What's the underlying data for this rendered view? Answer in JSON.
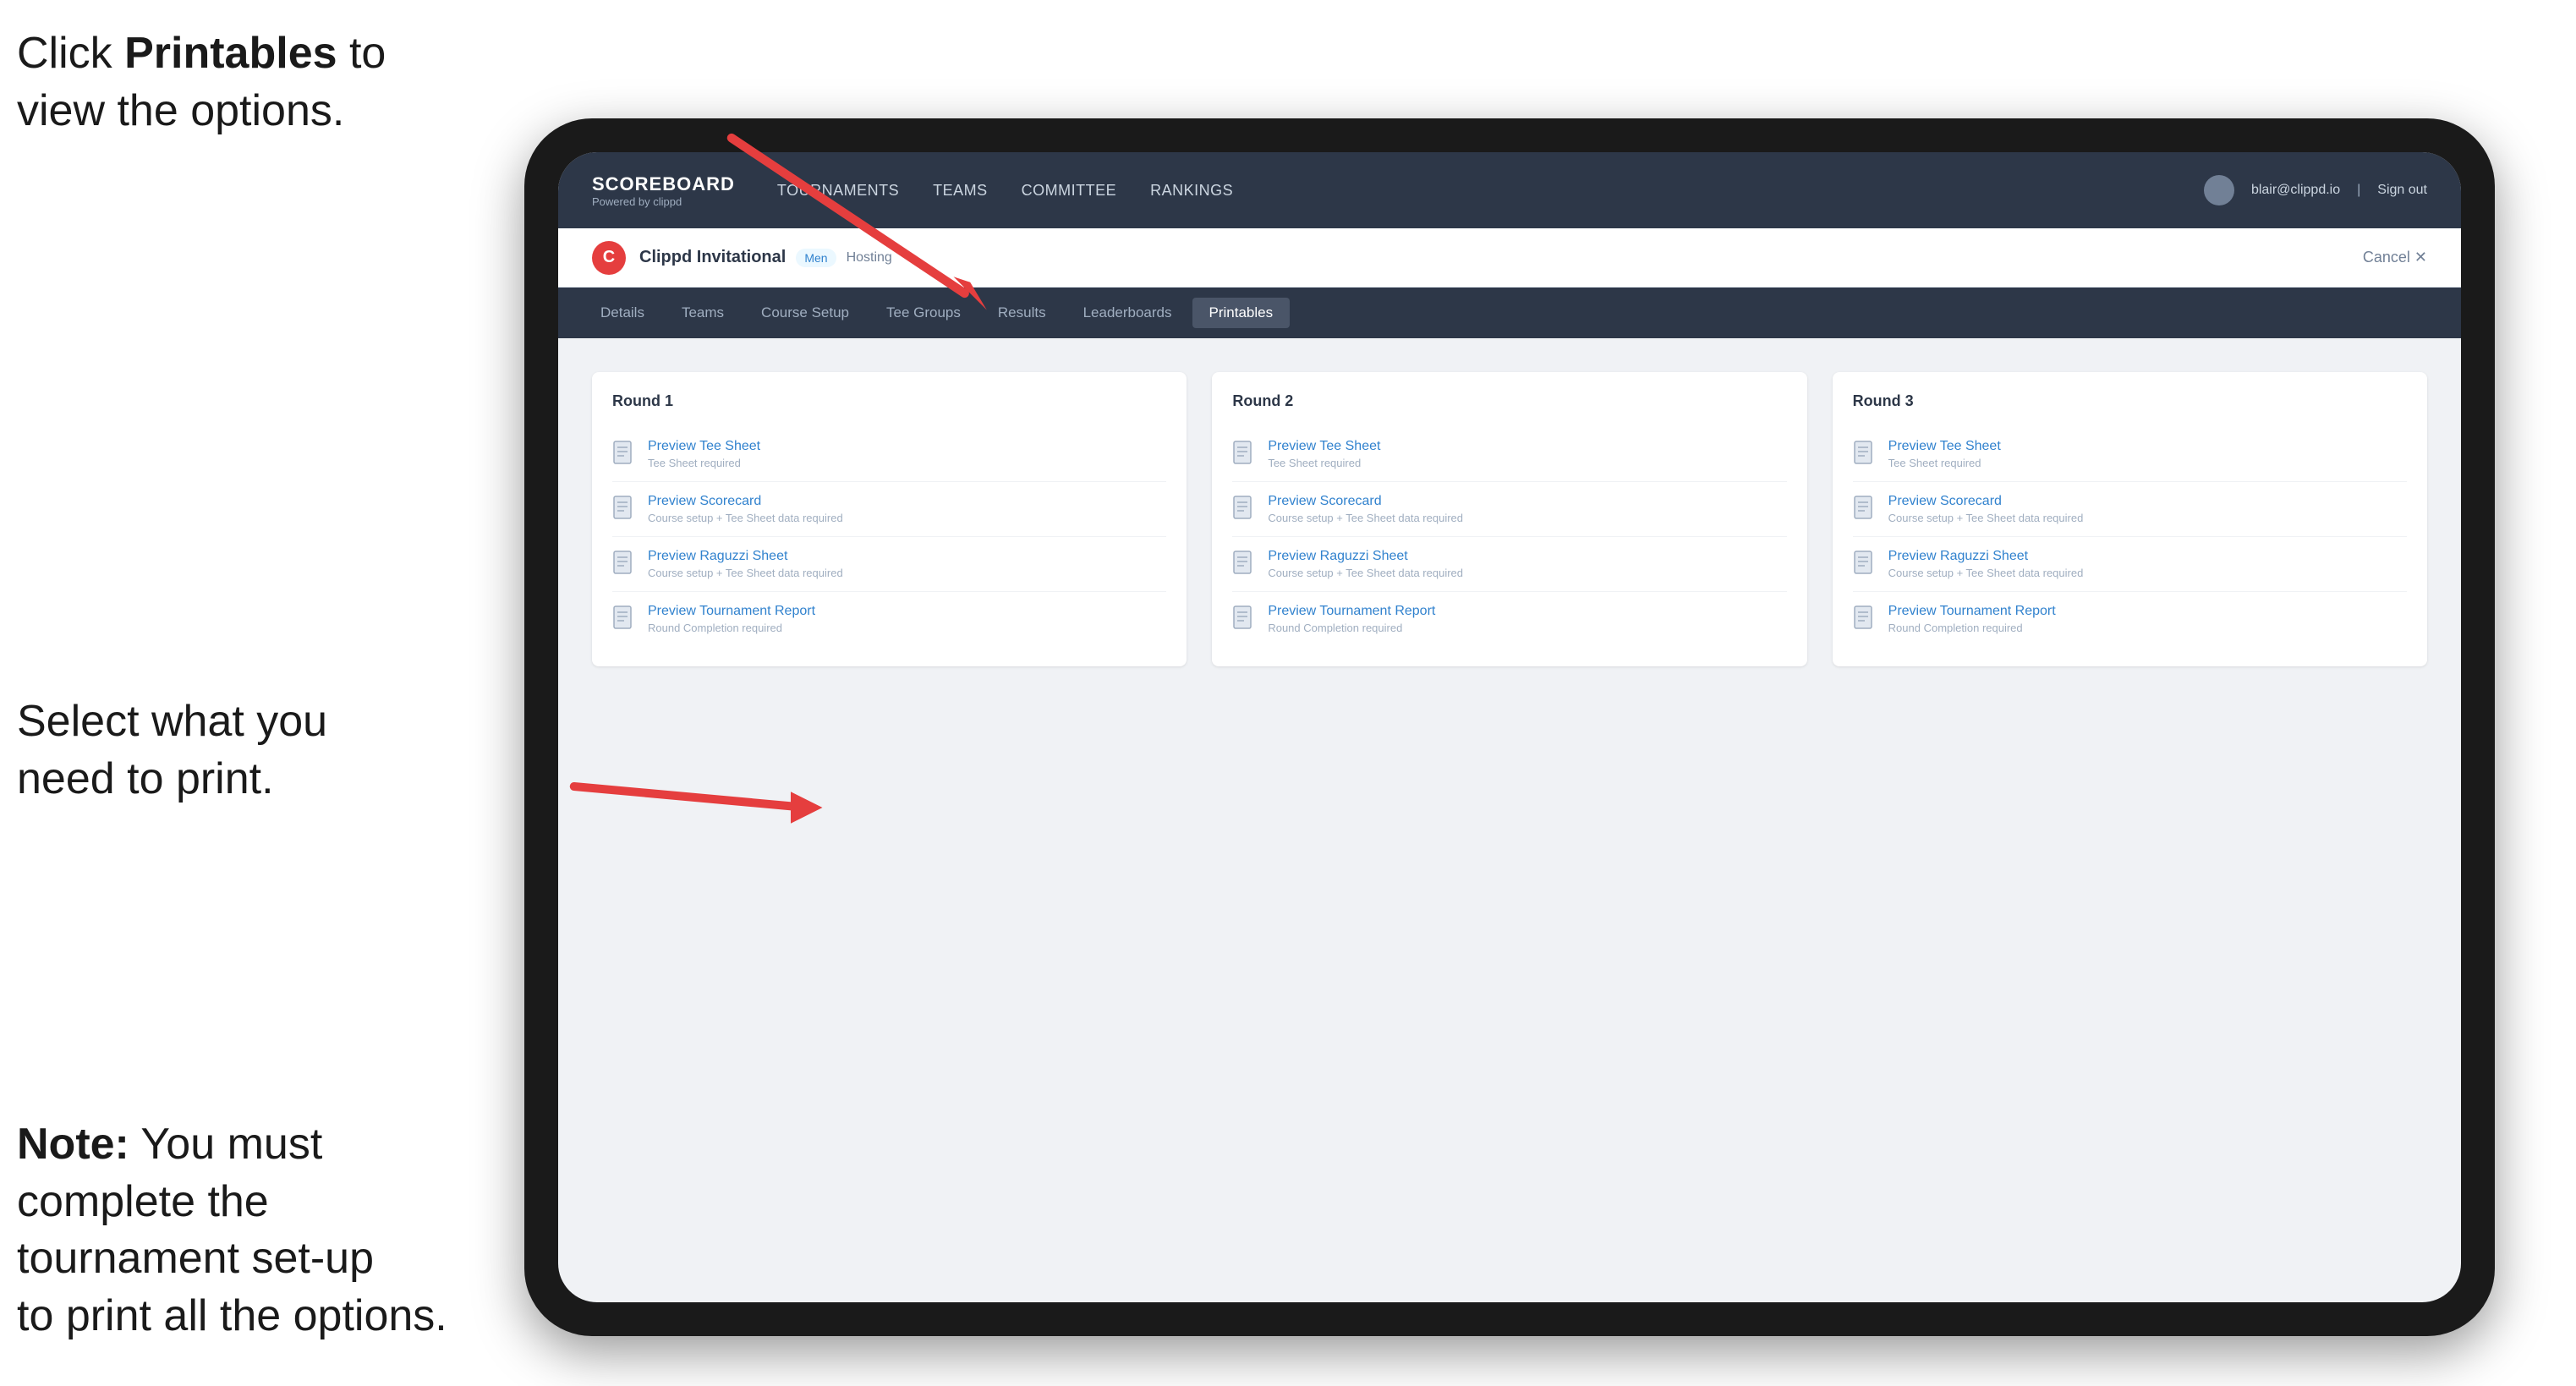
{
  "instructions": {
    "top_line1": "Click ",
    "top_bold": "Printables",
    "top_line2": " to",
    "top_line3": "view the options.",
    "middle": "Select what you\nneed to print.",
    "bottom_bold": "Note:",
    "bottom": " You must\ncomplete the\ntournament set-up\nto print all the options."
  },
  "nav": {
    "brand": "SCOREBOARD",
    "brand_sub": "Powered by clippd",
    "links": [
      "TOURNAMENTS",
      "TEAMS",
      "COMMITTEE",
      "RANKINGS"
    ],
    "user_email": "blair@clippd.io",
    "sign_out": "Sign out"
  },
  "tournament": {
    "name": "Clippd Invitational",
    "badge": "Men",
    "status": "Hosting",
    "cancel": "Cancel ✕"
  },
  "tabs": [
    "Details",
    "Teams",
    "Course Setup",
    "Tee Groups",
    "Results",
    "Leaderboards",
    "Printables"
  ],
  "active_tab": "Printables",
  "rounds": [
    {
      "title": "Round 1",
      "items": [
        {
          "title": "Preview Tee Sheet",
          "subtitle": "Tee Sheet required"
        },
        {
          "title": "Preview Scorecard",
          "subtitle": "Course setup + Tee Sheet data required"
        },
        {
          "title": "Preview Raguzzi Sheet",
          "subtitle": "Course setup + Tee Sheet data required"
        },
        {
          "title": "Preview Tournament Report",
          "subtitle": "Round Completion required"
        }
      ]
    },
    {
      "title": "Round 2",
      "items": [
        {
          "title": "Preview Tee Sheet",
          "subtitle": "Tee Sheet required"
        },
        {
          "title": "Preview Scorecard",
          "subtitle": "Course setup + Tee Sheet data required"
        },
        {
          "title": "Preview Raguzzi Sheet",
          "subtitle": "Course setup + Tee Sheet data required"
        },
        {
          "title": "Preview Tournament Report",
          "subtitle": "Round Completion required"
        }
      ]
    },
    {
      "title": "Round 3",
      "items": [
        {
          "title": "Preview Tee Sheet",
          "subtitle": "Tee Sheet required"
        },
        {
          "title": "Preview Scorecard",
          "subtitle": "Course setup + Tee Sheet data required"
        },
        {
          "title": "Preview Raguzzi Sheet",
          "subtitle": "Course setup + Tee Sheet data required"
        },
        {
          "title": "Preview Tournament Report",
          "subtitle": "Round Completion required"
        }
      ]
    }
  ],
  "colors": {
    "nav_bg": "#2d3748",
    "accent": "#e53e3e",
    "link": "#3182ce"
  }
}
